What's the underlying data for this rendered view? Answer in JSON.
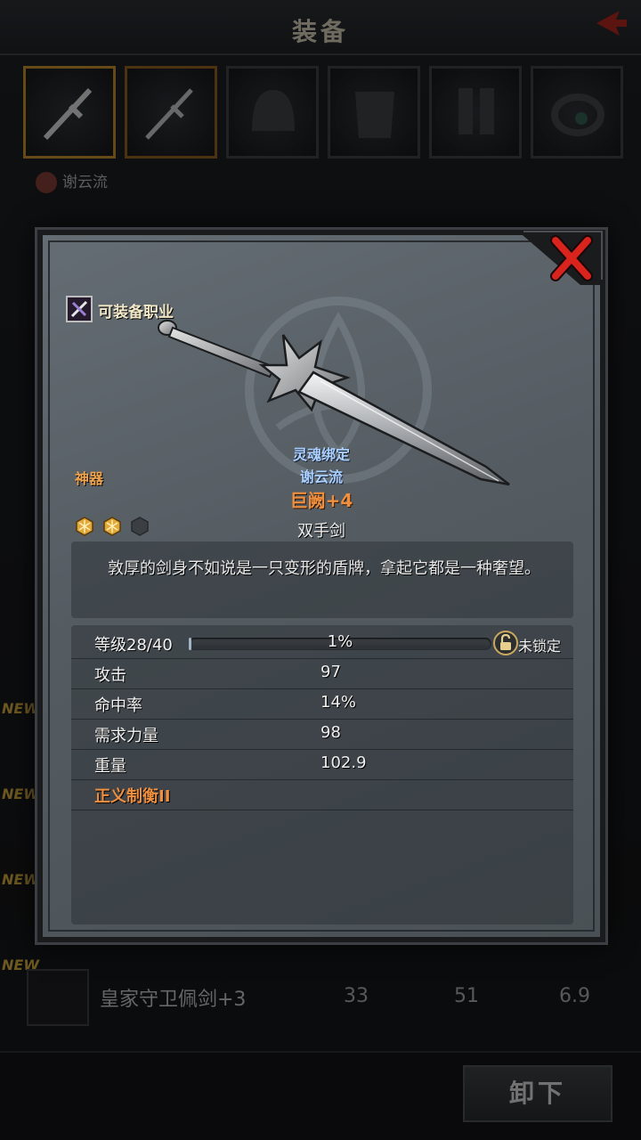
{
  "background": {
    "title": "装备",
    "owner_name": "谢云流",
    "new_badge": "NEW",
    "row": {
      "name": "皇家守卫佩剑+3",
      "values": [
        "33",
        "51",
        "6.9"
      ]
    },
    "unequip_label": "卸下"
  },
  "modal": {
    "job_label": "可装备职业",
    "rarity": "神器",
    "soulbound_line1": "灵魂绑定",
    "soulbound_line2": "谢云流",
    "item_name": "巨阙+4",
    "item_type": "双手剑",
    "gems": {
      "filled": 2,
      "total": 3
    },
    "description": "敦厚的剑身不如说是一只变形的盾牌，拿起它都是一种奢望。",
    "level": {
      "label": "等级28/40",
      "progress_percent": 1,
      "progress_text": "1%",
      "lock_state": "未锁定"
    },
    "stats": [
      {
        "label": "攻击",
        "value": "97"
      },
      {
        "label": "命中率",
        "value": "14%"
      },
      {
        "label": "需求力量",
        "value": "98"
      },
      {
        "label": "重量",
        "value": "102.9"
      }
    ],
    "skill": "正义制衡II"
  },
  "colors": {
    "rarity": "#f0a44e",
    "item_name": "#f08f3e",
    "soulbound": "#a9d0ff",
    "gem_filled": "#e2a83a",
    "gem_empty": "#3b3f44",
    "close_red": "#d8241c"
  }
}
